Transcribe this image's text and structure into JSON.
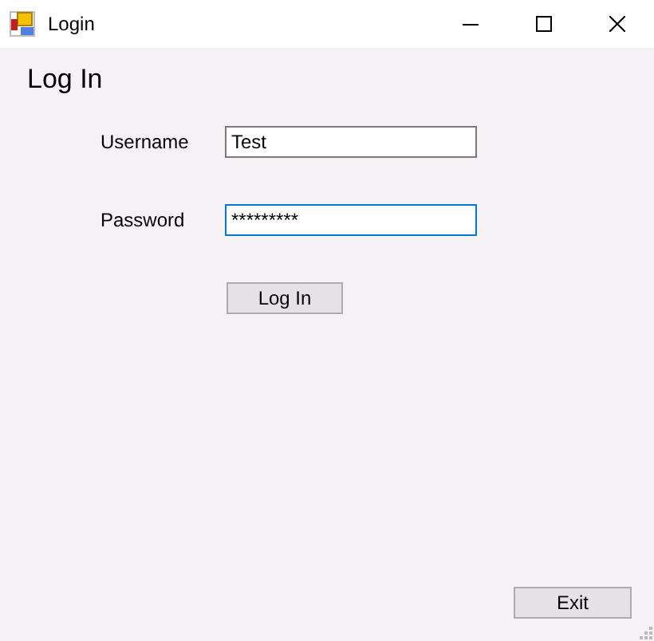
{
  "window": {
    "title": "Login"
  },
  "heading": "Log In",
  "fields": [
    {
      "label": "Username",
      "value": "Test",
      "focused": false
    },
    {
      "label": "Password",
      "value": "*********",
      "focused": true
    }
  ],
  "buttons": [
    {
      "kind": "login",
      "label": "Log In"
    },
    {
      "kind": "exit",
      "label": "Exit"
    }
  ]
}
